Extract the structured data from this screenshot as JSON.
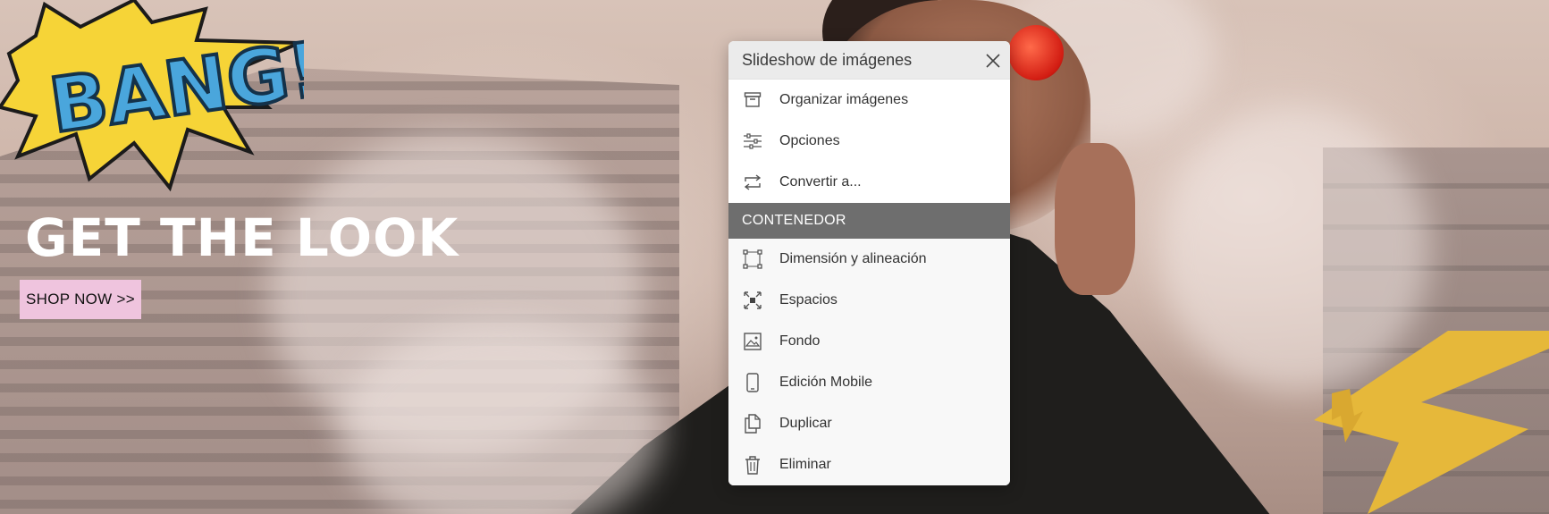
{
  "hero": {
    "title": "GET THE LOOK",
    "cta_label": "SHOP NOW >>",
    "cta_color": "#efc4de",
    "badge_text": "BANG!"
  },
  "panel": {
    "title": "Slideshow de imágenes",
    "close_icon": "close-icon",
    "items_top": [
      {
        "label": "Organizar imágenes",
        "icon": "archive-box-icon"
      },
      {
        "label": "Opciones",
        "icon": "sliders-icon"
      },
      {
        "label": "Convertir a...",
        "icon": "convert-arrows-icon"
      }
    ],
    "section_label": "CONTENEDOR",
    "section_color": "#6e6e6e",
    "items_bottom": [
      {
        "label": "Dimensión y alineación",
        "icon": "resize-frame-icon"
      },
      {
        "label": "Espacios",
        "icon": "spacing-icon"
      },
      {
        "label": "Fondo",
        "icon": "image-background-icon"
      },
      {
        "label": "Edición Mobile",
        "icon": "mobile-phone-icon"
      },
      {
        "label": "Duplicar",
        "icon": "duplicate-icon"
      },
      {
        "label": "Eliminar",
        "icon": "trash-icon"
      }
    ]
  }
}
